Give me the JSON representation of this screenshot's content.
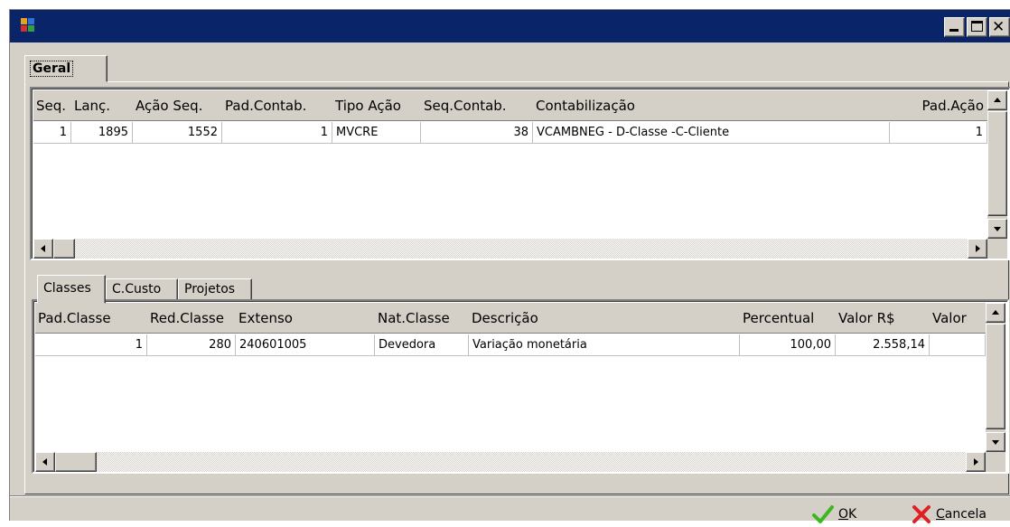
{
  "window": {
    "title": ""
  },
  "main_tab": {
    "label": "Geral"
  },
  "top_grid": {
    "columns": [
      "Seq.",
      "Lanç.",
      "Ação Seq.",
      "Pad.Contab.",
      "Tipo Ação",
      "Seq.Contab.",
      "Contabilização",
      "Pad.Ação"
    ],
    "rows": [
      [
        "1",
        "1895",
        "1552",
        "1",
        "MVCRE",
        "38",
        "VCAMBNEG - D-Classe -C-Cliente",
        "1"
      ]
    ]
  },
  "sub_tabs": [
    "Classes",
    "C.Custo",
    "Projetos"
  ],
  "bottom_grid": {
    "columns": [
      "Pad.Classe",
      "Red.Classe",
      "Extenso",
      "Nat.Classe",
      "Descrição",
      "Percentual",
      "Valor R$",
      "Valor"
    ],
    "rows": [
      [
        "1",
        "280",
        "240601005",
        "Devedora",
        "Variação monetária",
        "100,00",
        "2.558,14",
        ""
      ]
    ]
  },
  "buttons": {
    "ok": {
      "mnemonic": "O",
      "rest": "K"
    },
    "cancel": {
      "mnemonic": "C",
      "rest": "ancela"
    }
  },
  "colors": {
    "titlebar": "#0a246a",
    "face": "#d4d0c8",
    "ok_icon": "#3cb81e",
    "cancel_icon": "#e02020"
  },
  "icons": {
    "app": "app-logo-icon",
    "ok": "checkmark-icon",
    "cancel": "x-icon"
  }
}
